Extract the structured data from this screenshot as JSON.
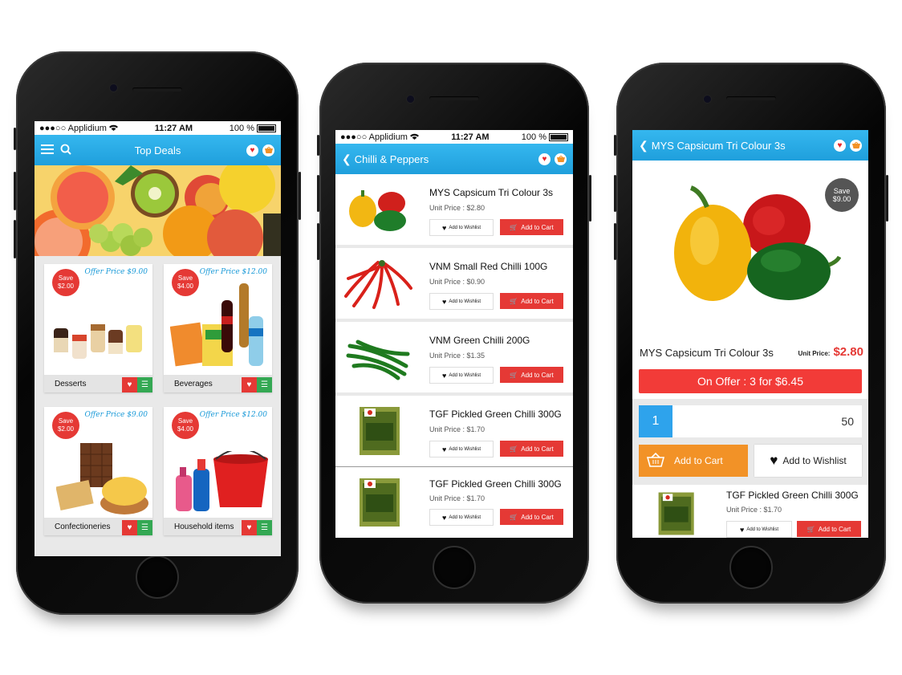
{
  "colors": {
    "accent_blue": "#1f9fdc",
    "red": "#e53935",
    "green": "#34a853",
    "orange": "#f29227"
  },
  "status_bar": {
    "carrier": "●●●○○ Applidium",
    "wifi_icon": "wifi-icon",
    "time": "11:27 AM",
    "battery": "100 %"
  },
  "screen1": {
    "title": "Top Deals",
    "tiles": [
      {
        "save": "Save",
        "save_amt": "$2.00",
        "offer": "Offer Price $9.00",
        "label": "Desserts"
      },
      {
        "save": "Save",
        "save_amt": "$4.00",
        "offer": "Offer Price $12.00",
        "label": "Beverages"
      },
      {
        "save": "Save",
        "save_amt": "$2.00",
        "offer": "Offer Price $9.00",
        "label": "Confectioneries"
      },
      {
        "save": "Save",
        "save_amt": "$4.00",
        "offer": "Offer Price $12.00",
        "label": "Household items"
      }
    ]
  },
  "screen2": {
    "title": "Chilli & Peppers",
    "wishlist_label": "Add to Wishlist",
    "cart_label": "Add to Cart",
    "products": [
      {
        "name": "MYS Capsicum Tri Colour 3s",
        "price": "Unit Price : $2.80"
      },
      {
        "name": "VNM Small Red Chilli 100G",
        "price": "Unit Price : $0.90"
      },
      {
        "name": "VNM Green Chilli 200G",
        "price": "Unit Price : $1.35"
      },
      {
        "name": "TGF Pickled Green Chilli 300G",
        "price": "Unit Price : $1.70"
      },
      {
        "name": "TGF Pickled Green Chilli 300G",
        "price": "Unit Price : $1.70"
      }
    ]
  },
  "screen3": {
    "title": "MYS Capsicum Tri Colour 3s",
    "save": "Save",
    "save_amt": "$9.00",
    "product_name": "MYS Capsicum Tri Colour 3s",
    "unit_price_label": "Unit Price:",
    "unit_price": "$2.80",
    "offer_banner": "On Offer : 3 for $6.45",
    "quantity": "1",
    "stock": "50",
    "add_to_cart": "Add to Cart",
    "add_to_wishlist": "Add to Wishlist",
    "related": {
      "name": "TGF Pickled Green Chilli 300G",
      "price": "Unit Price : $1.70",
      "wishlist_label": "Add to Wishlist",
      "cart_label": "Add to Cart"
    }
  }
}
